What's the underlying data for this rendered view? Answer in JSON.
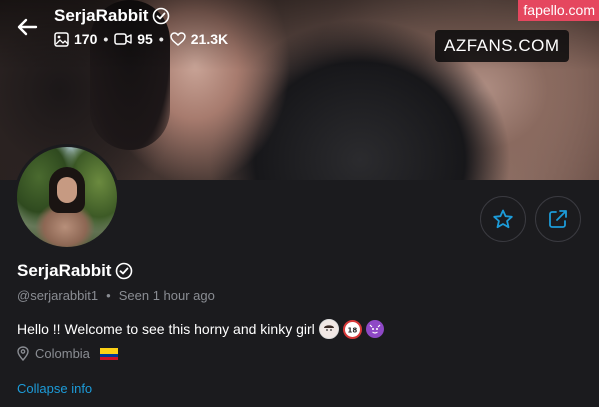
{
  "header": {
    "username": "SerjaRabbit",
    "stats": {
      "photos": "170",
      "videos": "95",
      "likes": "21.3K"
    }
  },
  "watermarks": {
    "top_right": "fapello.com",
    "cover": "AZFANS.COM"
  },
  "profile": {
    "display_name": "SerjaRabbit",
    "handle": "@serjarabbit1",
    "seen_label": "Seen",
    "seen_time": "1 hour ago",
    "bio": "Hello !! Welcome to see this horny and kinky girl",
    "location": "Colombia",
    "collapse_label": "Collapse info"
  },
  "icons": {
    "back": "arrow-left-icon",
    "verified": "verified-badge-icon",
    "photo": "image-icon",
    "video": "video-icon",
    "like": "heart-icon",
    "favorite": "star-icon",
    "share": "share-icon",
    "location": "map-pin-icon"
  },
  "colors": {
    "background": "#1b1b1e",
    "accent": "#1c9bd8",
    "muted_text": "#8a8d93",
    "watermark": "#e5475f"
  }
}
